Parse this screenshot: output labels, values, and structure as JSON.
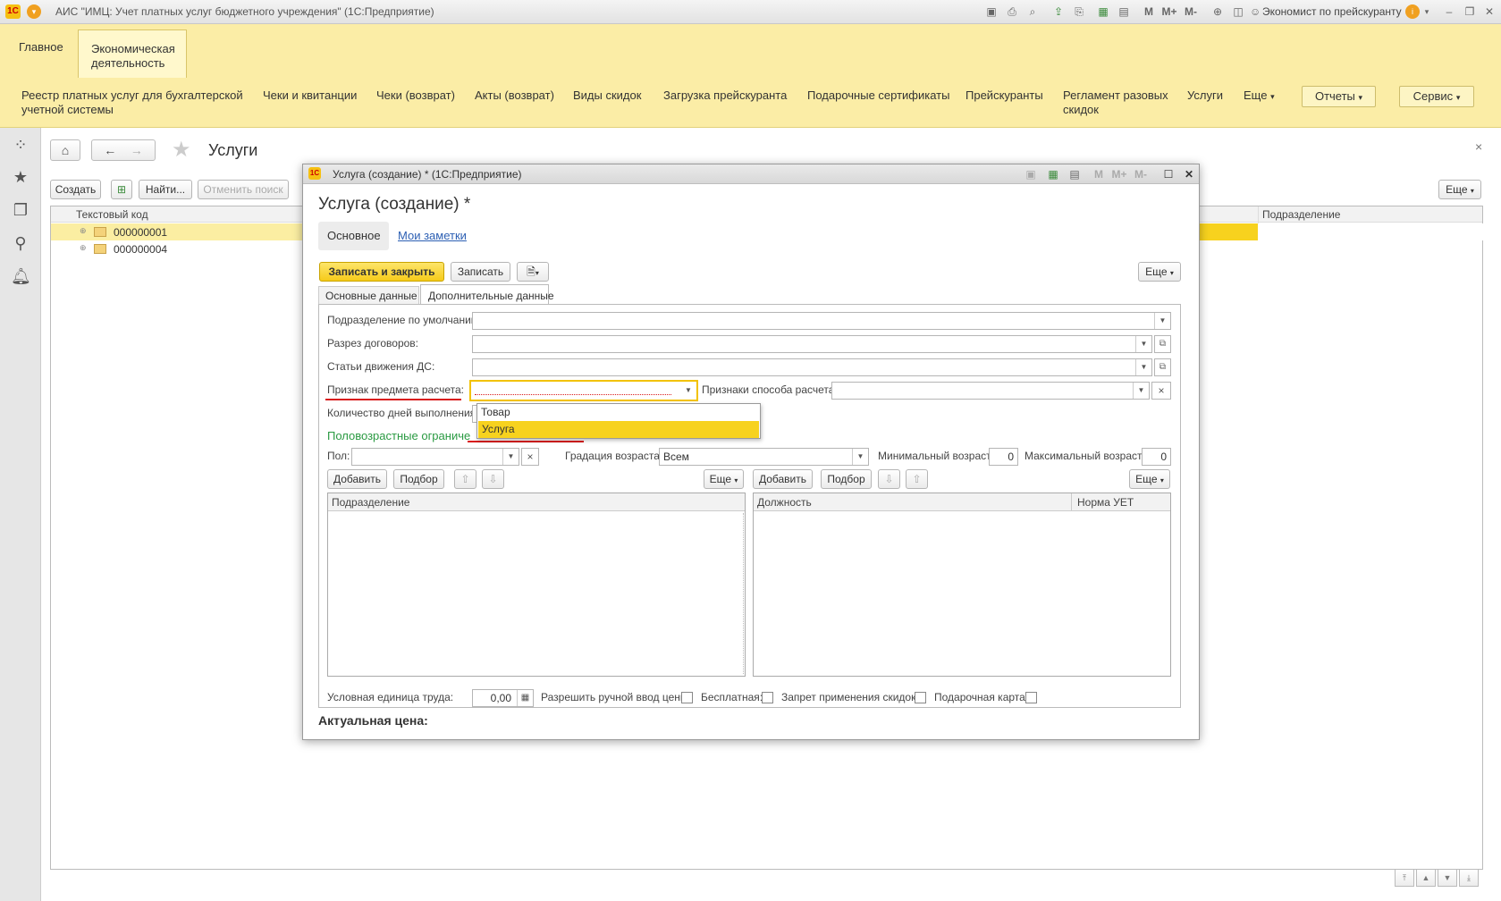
{
  "app": {
    "title": "АИС \"ИМЦ: Учет платных услуг бюджетного учреждения\"  (1С:Предприятие)",
    "user": "Экономист по прейскуранту",
    "m_buttons": [
      "M",
      "M+",
      "M-"
    ]
  },
  "sections": [
    "Главное",
    "Экономическая деятельность"
  ],
  "subnav": {
    "items": [
      "Реестр платных услуг для бухгалтерской учетной системы",
      "Чеки и квитанции",
      "Чеки (возврат)",
      "Акты (возврат)",
      "Виды скидок",
      "Загрузка прейскуранта",
      "Подарочные сертификаты",
      "Прейскуранты",
      "Регламент разовых скидок",
      "Услуги"
    ],
    "more": "Еще",
    "reports": "Отчеты",
    "service": "Сервис"
  },
  "list": {
    "title": "Услуги",
    "create": "Создать",
    "find": "Найти...",
    "cancel_search": "Отменить поиск",
    "more": "Еще",
    "columns": [
      "Текстовый код",
      "Подразделение"
    ],
    "rows": [
      "000000001",
      "000000004"
    ]
  },
  "dialog": {
    "window_title": "Услуга (создание) *  (1С:Предприятие)",
    "heading": "Услуга (создание) *",
    "tab_main": "Основное",
    "tab_notes": "Мои заметки",
    "save_close": "Записать и закрыть",
    "save": "Записать",
    "more": "Еще",
    "subtabs": [
      "Основные данные",
      "Дополнительные данные"
    ],
    "fields": {
      "default_dept": "Подразделение по умолчанию:",
      "contract_section": "Разрез договоров:",
      "cash_flow": "Статьи движения ДС:",
      "subject_sign": "Признак предмета расчета:",
      "payment_method": "Признаки способа расчета:",
      "days_count": "Количество дней выполнения:",
      "restrictions_group": "Половозрастные ограничения",
      "gender": "Пол:",
      "age_gradation": "Градация возраста:",
      "age_gradation_value": "Всем",
      "min_age": "Минимальный возраст:",
      "min_age_value": "0",
      "max_age": "Максимальный возраст:",
      "max_age_value": "0",
      "labor_unit": "Условная единица труда:",
      "labor_unit_value": "0,00",
      "manual_price": "Разрешить ручной ввод цены:",
      "free": "Бесплатная:",
      "no_discounts": "Запрет применения скидок:",
      "gift_card": "Подарочная карта:",
      "actual_price": "Актуальная цена:"
    },
    "dropdown_options": [
      "Товар",
      "Услуга"
    ],
    "left_table": {
      "add": "Добавить",
      "pick": "Подбор",
      "more": "Еще",
      "columns": [
        "Подразделение"
      ]
    },
    "right_table": {
      "add": "Добавить",
      "pick": "Подбор",
      "more": "Еще",
      "columns": [
        "Должность",
        "Норма УЕТ"
      ]
    }
  }
}
